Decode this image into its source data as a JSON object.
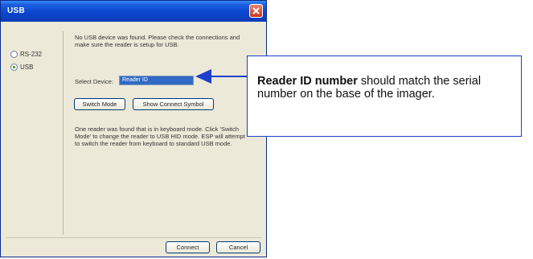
{
  "window": {
    "title": "USB"
  },
  "radios": [
    {
      "label": "RS-232",
      "checked": false
    },
    {
      "label": "USB",
      "checked": true
    }
  ],
  "info_text": "No USB device was found. Please check the connections and make sure the reader is setup for USB.",
  "select_device": {
    "label": "Select Device:",
    "value": "Reader ID"
  },
  "buttons": {
    "switch_mode": "Switch Mode",
    "show_connect_symbol": "Show Connect Symbol",
    "connect": "Connect",
    "cancel": "Cancel"
  },
  "keyboard_text": "One reader was found that is in keyboard mode. Click 'Switch Mode' to change the reader to USB HID mode. ESP will attempt to switch the reader from keyboard to standard USB mode.",
  "callout": {
    "bold": "Reader ID number",
    "rest": " should match the serial number on the base of the imager."
  },
  "colors": {
    "title_bar": "#0a46cf",
    "callout_border": "#1e3fcc",
    "arrow": "#1e3fcc",
    "selection": "#316ac5"
  }
}
